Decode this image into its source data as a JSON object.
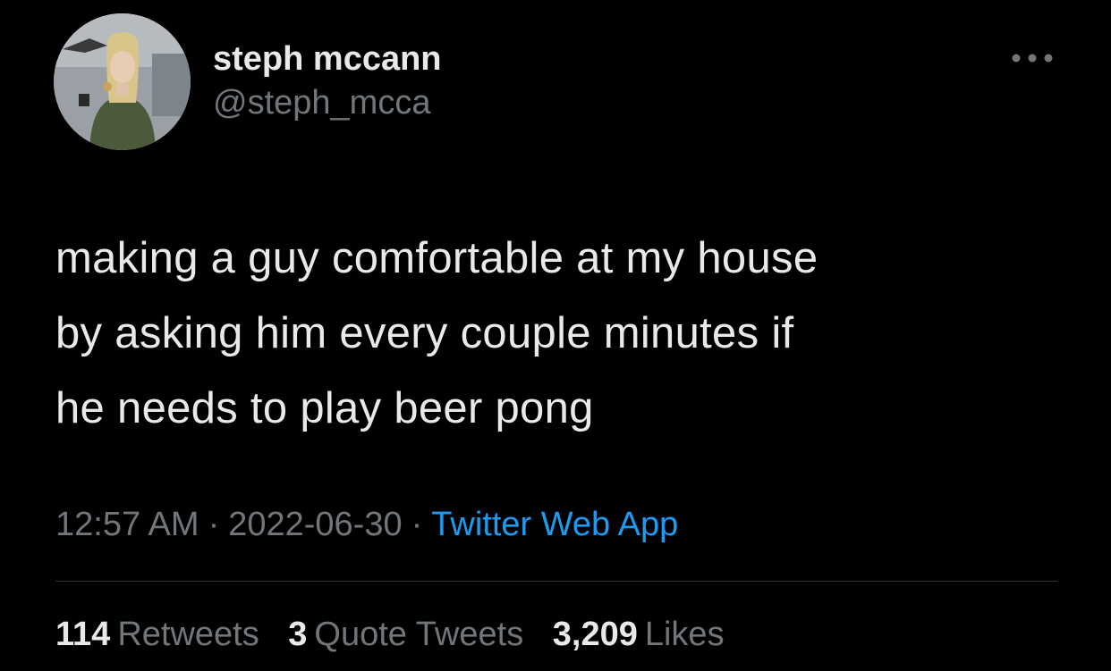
{
  "author": {
    "display_name": "steph mccann",
    "handle": "@steph_mcca",
    "avatar_icon": "profile-photo"
  },
  "more_icon": "more-horizontal-icon",
  "tweet": {
    "text": "making a guy comfortable at my house\nby asking him every couple minutes if\nhe needs to play beer pong"
  },
  "meta": {
    "time": "12:57 AM",
    "separator": "·",
    "date": "2022-06-30",
    "source": "Twitter Web App"
  },
  "stats": {
    "retweets_count": "114",
    "retweets_label": "Retweets",
    "quotes_count": "3",
    "quotes_label": "Quote Tweets",
    "likes_count": "3,209",
    "likes_label": "Likes"
  },
  "colors": {
    "background": "#000000",
    "primary_text": "#e7e9ea",
    "secondary_text": "#71767b",
    "link": "#1d9bf0",
    "divider": "#2f3336"
  }
}
